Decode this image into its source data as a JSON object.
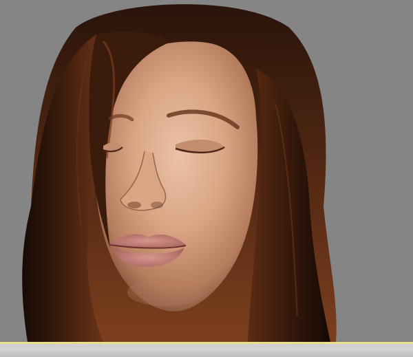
{
  "viewport": {
    "background_color": "#858585",
    "subject": "3d-rendered-female-head",
    "eyes_state": "closed"
  },
  "colors": {
    "viewport_bg": "#858585",
    "skin_light": "#e2b69a",
    "skin_mid": "#c98e70",
    "skin_shadow": "#7a4a36",
    "hair_dark": "#1e0f08",
    "hair_mid": "#4a2412",
    "hair_highlight": "#8a4a26",
    "lips": "#c27c76",
    "brows": "#6b3a22",
    "timeline_accent": "#e8e089",
    "timeline_bg": "#cfcfcf"
  },
  "timeline": {
    "accent_color": "#e8e089"
  }
}
